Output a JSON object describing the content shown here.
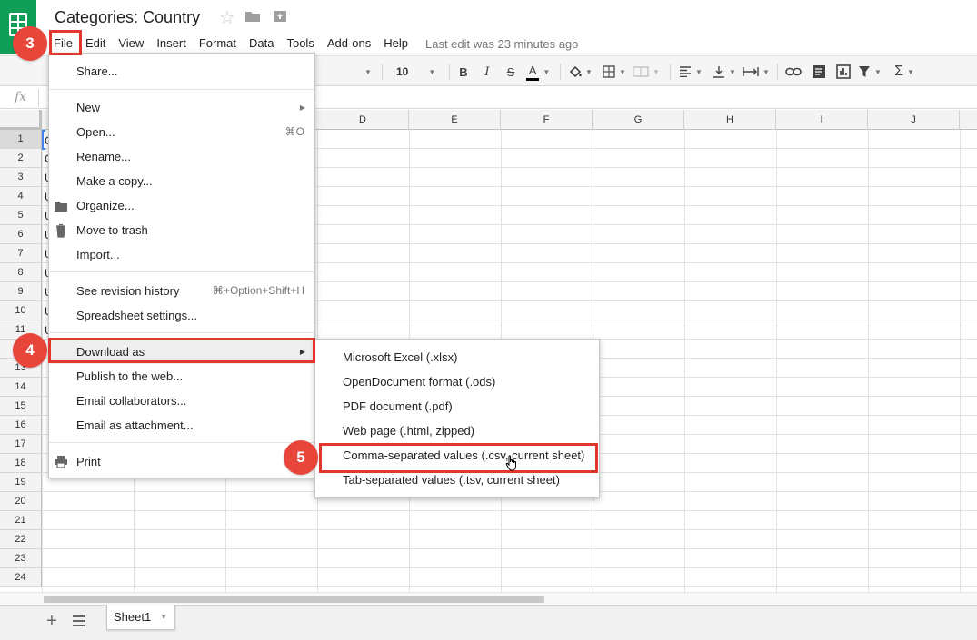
{
  "header": {
    "title": "Categories: Country",
    "last_edit": "Last edit was 23 minutes ago"
  },
  "menubar": [
    "File",
    "Edit",
    "View",
    "Insert",
    "Format",
    "Data",
    "Tools",
    "Add-ons",
    "Help"
  ],
  "toolbar": {
    "font_size": "10",
    "bold": "B",
    "italic": "I",
    "strike": "S",
    "text_color": "A",
    "sum": "Σ"
  },
  "formula_bar": {
    "fx_label": "fx"
  },
  "columns": [
    "D",
    "E",
    "F",
    "G",
    "H",
    "I",
    "J"
  ],
  "rows": [
    "1",
    "2",
    "3",
    "4",
    "5",
    "6",
    "7",
    "8",
    "9",
    "10",
    "11",
    "12",
    "13",
    "14",
    "15",
    "16",
    "17",
    "18",
    "19",
    "20",
    "21",
    "22",
    "23",
    "24"
  ],
  "visible_cell_fragments": [
    "C",
    "C",
    "U",
    "U",
    "U",
    "U",
    "U",
    "U",
    "U",
    "U",
    "U"
  ],
  "file_menu": {
    "share": "Share...",
    "new": "New",
    "open": "Open...",
    "open_shortcut": "⌘O",
    "rename": "Rename...",
    "make_copy": "Make a copy...",
    "organize": "Organize...",
    "move_to_trash": "Move to trash",
    "import": "Import...",
    "revision_history": "See revision history",
    "revision_shortcut": "⌘+Option+Shift+H",
    "spreadsheet_settings": "Spreadsheet settings...",
    "download_as": "Download as",
    "publish": "Publish to the web...",
    "email_collaborators": "Email collaborators...",
    "email_attachment": "Email as attachment...",
    "print": "Print"
  },
  "download_submenu": [
    "Microsoft Excel (.xlsx)",
    "OpenDocument format (.ods)",
    "PDF document (.pdf)",
    "Web page (.html, zipped)",
    "Comma-separated values (.csv, current sheet)",
    "Tab-separated values (.tsv, current sheet)"
  ],
  "sheet_tabs": {
    "active": "Sheet1"
  },
  "annotations": {
    "step3": "3",
    "step4": "4",
    "step5": "5"
  },
  "colors": {
    "brand_green": "#0f9d58",
    "annotation_red": "#e8463b",
    "selection_blue": "#4285f4"
  }
}
